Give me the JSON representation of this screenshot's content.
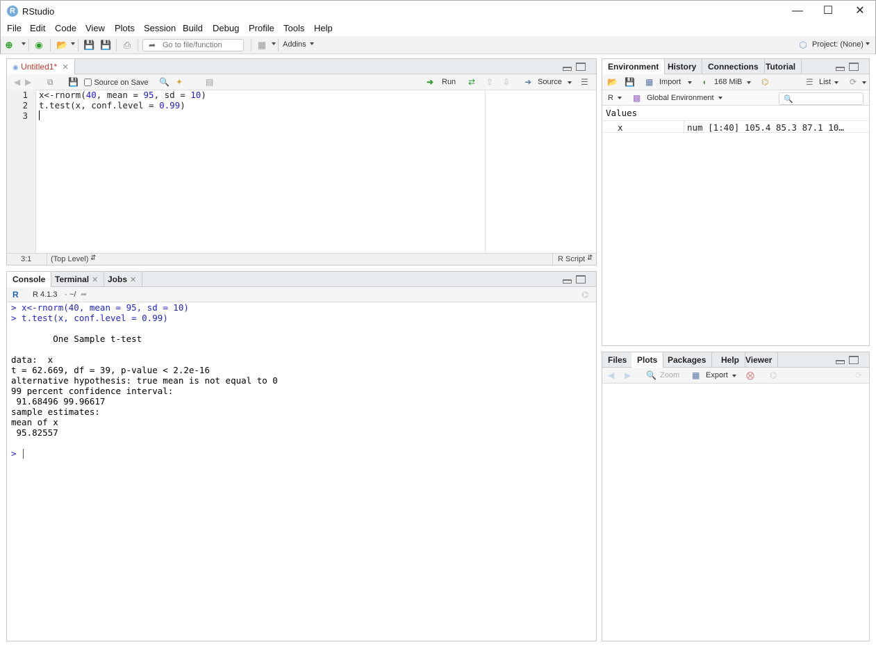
{
  "window": {
    "title": "RStudio",
    "app_icon": "R"
  },
  "menubar": [
    "File",
    "Edit",
    "Code",
    "View",
    "Plots",
    "Session",
    "Build",
    "Debug",
    "Profile",
    "Tools",
    "Help"
  ],
  "toolbar": {
    "goto_placeholder": "Go to file/function",
    "addins_label": "Addins",
    "project_label": "Project: (None)"
  },
  "editor": {
    "tab_label": "Untitled1*",
    "source_on_save": "Source on Save",
    "run_label": "Run",
    "source_label": "Source",
    "lines": [
      {
        "num": "1",
        "code": "x<-rnorm(40, mean = 95, sd = 10)"
      },
      {
        "num": "2",
        "code": "t.test(x, conf.level = 0.99)"
      },
      {
        "num": "3",
        "code": ""
      }
    ],
    "status_position": "3:1",
    "status_scope": "(Top Level)",
    "status_filetype": "R Script"
  },
  "console": {
    "tabs": [
      "Console",
      "Terminal",
      "Jobs"
    ],
    "r_version": "R 4.1.3",
    "path": "~/",
    "lines": [
      {
        "text": "> x<-rnorm(40, mean = 95, sd = 10)",
        "input": true
      },
      {
        "text": "> t.test(x, conf.level = 0.99)",
        "input": true
      },
      {
        "text": "",
        "input": false
      },
      {
        "text": "        One Sample t-test",
        "input": false
      },
      {
        "text": "",
        "input": false
      },
      {
        "text": "data:  x",
        "input": false
      },
      {
        "text": "t = 62.669, df = 39, p-value < 2.2e-16",
        "input": false
      },
      {
        "text": "alternative hypothesis: true mean is not equal to 0",
        "input": false
      },
      {
        "text": "99 percent confidence interval:",
        "input": false
      },
      {
        "text": " 91.68496 99.96617",
        "input": false
      },
      {
        "text": "sample estimates:",
        "input": false
      },
      {
        "text": "mean of x ",
        "input": false
      },
      {
        "text": " 95.82557 ",
        "input": false
      },
      {
        "text": "",
        "input": false
      },
      {
        "text": "> ",
        "input": true
      }
    ]
  },
  "environment": {
    "tabs": [
      "Environment",
      "History",
      "Connections",
      "Tutorial"
    ],
    "import_label": "Import",
    "memory_label": "168 MiB",
    "list_label": "List",
    "r_label": "R",
    "scope_label": "Global Environment",
    "values_header": "Values",
    "rows": [
      {
        "name": "x",
        "value": "num [1:40] 105.4 85.3 87.1 10…"
      }
    ]
  },
  "files": {
    "tabs": [
      "Files",
      "Plots",
      "Packages",
      "Help",
      "Viewer"
    ],
    "zoom_label": "Zoom",
    "export_label": "Export"
  },
  "colors": {
    "accent": "#75aadb",
    "console_input": "#1e24c8",
    "numeric_literal": "#1c1cd6"
  }
}
